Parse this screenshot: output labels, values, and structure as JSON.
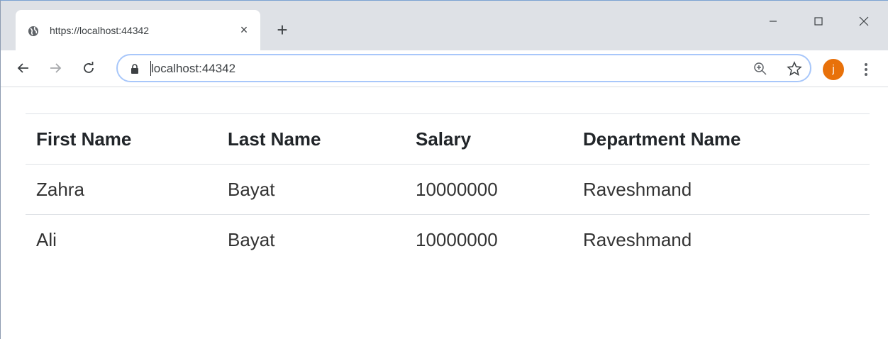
{
  "browser": {
    "tab_title": "https://localhost:44342",
    "new_tab_symbol": "+",
    "close_symbol": "×",
    "address": "localhost:44342",
    "profile_initial": "j"
  },
  "table": {
    "headers": [
      "First Name",
      "Last Name",
      "Salary",
      "Department Name"
    ],
    "rows": [
      [
        "Zahra",
        "Bayat",
        "10000000",
        "Raveshmand"
      ],
      [
        "Ali",
        "Bayat",
        "10000000",
        "Raveshmand"
      ]
    ]
  },
  "colors": {
    "avatar": "#e8710a",
    "omnibox_border": "#a8c7fa",
    "tabstrip": "#dee1e6"
  }
}
